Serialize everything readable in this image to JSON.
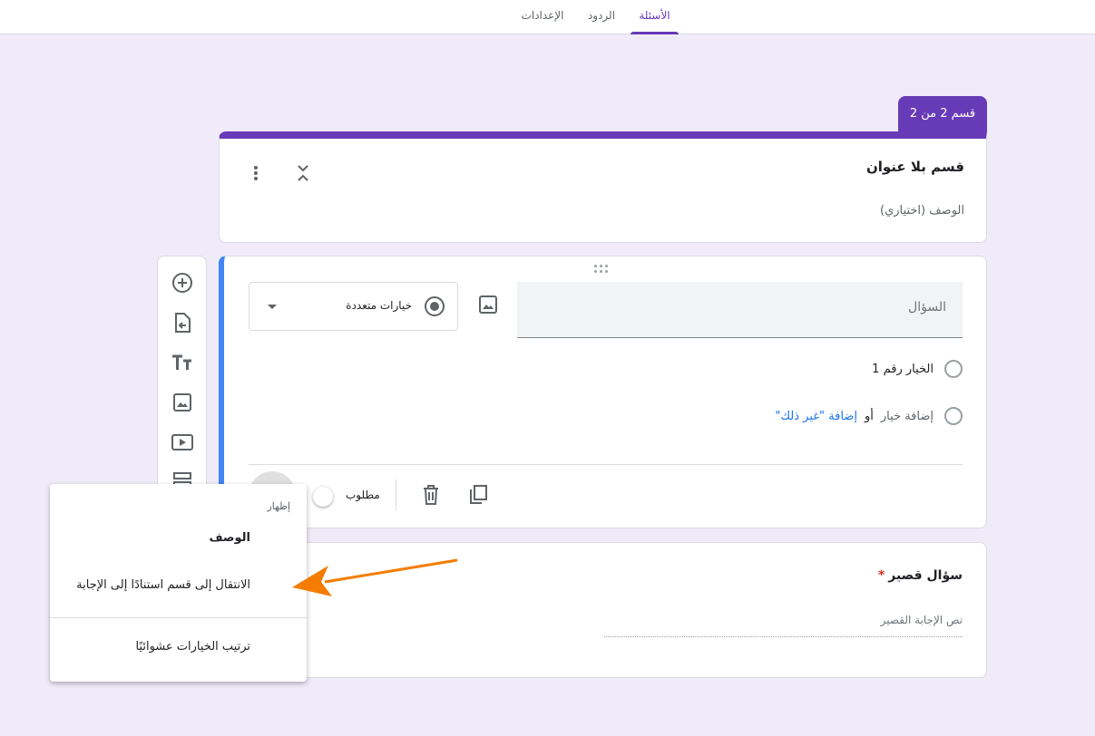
{
  "tabs": [
    {
      "label": "الأسئلة",
      "active": true
    },
    {
      "label": "الردود",
      "active": false
    },
    {
      "label": "الإعدادات",
      "active": false
    }
  ],
  "section_badge": "قسم 2 من 2",
  "section": {
    "title": "قسم بلا عنوان",
    "description_placeholder": "الوصف (اختياري)"
  },
  "toolbar": {
    "icons": [
      "add-question-icon",
      "import-questions-icon",
      "add-title-icon",
      "add-image-icon",
      "add-video-icon",
      "add-section-icon"
    ]
  },
  "question": {
    "placeholder": "السؤال",
    "type_label": "خيارات متعددة",
    "option_1": "الخيار رقم 1",
    "add_option": "إضافة خيار",
    "or": "أو",
    "add_other": "إضافة \"غير ذلك\"",
    "required_label": "مطلوب"
  },
  "short_question": {
    "title": "سؤال قصير",
    "required_star": "*",
    "answer_placeholder": "نص الإجابة القصير"
  },
  "menu": {
    "header": "إظهار",
    "items": [
      "الوصف",
      "الانتقال إلى قسم استنادًا إلى الإجابة",
      "ترتيب الخيارات عشوائيًا"
    ]
  },
  "colors": {
    "accent": "#673ab7",
    "active_question_border": "#4285f4",
    "background": "#f0ebf8",
    "annotation_arrow": "#f57c00"
  }
}
